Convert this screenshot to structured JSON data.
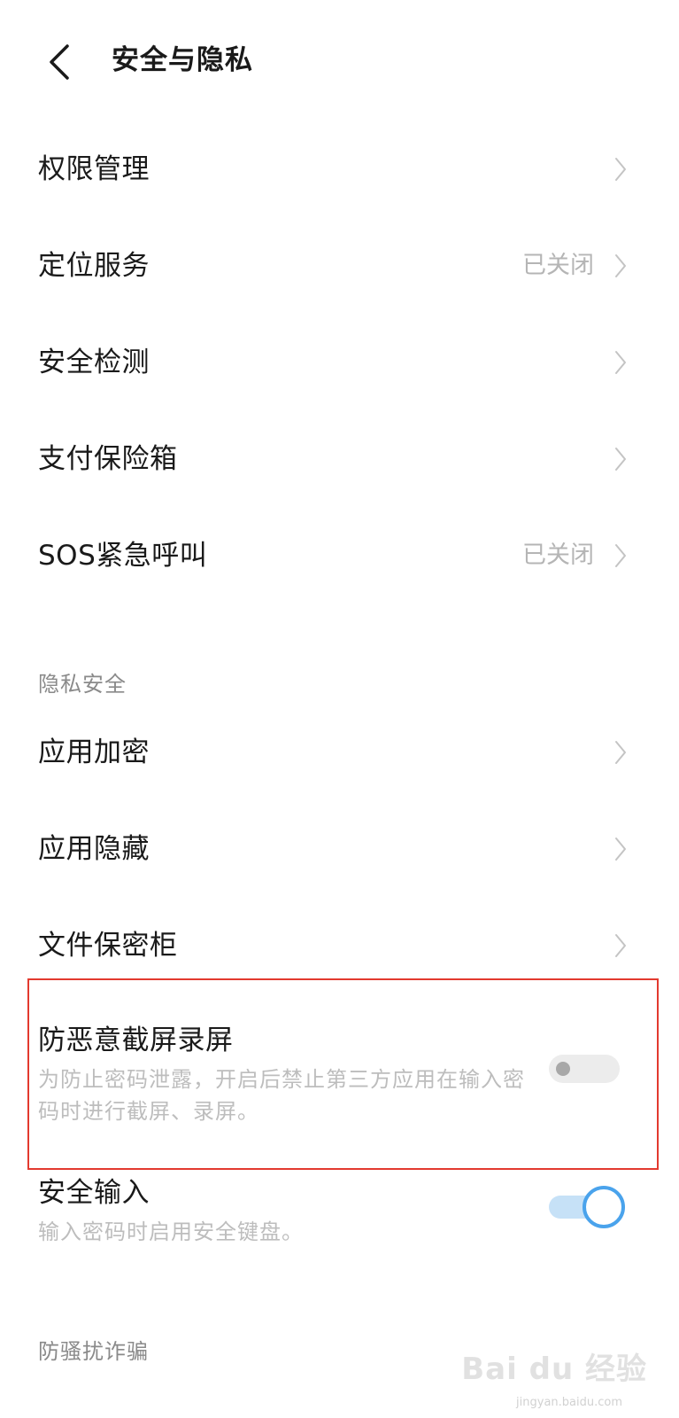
{
  "header": {
    "title": "安全与隐私"
  },
  "main_items": [
    {
      "label": "权限管理",
      "status": ""
    },
    {
      "label": "定位服务",
      "status": "已关闭"
    },
    {
      "label": "安全检测",
      "status": ""
    },
    {
      "label": "支付保险箱",
      "status": ""
    },
    {
      "label": "SOS紧急呼叫",
      "status": "已关闭"
    }
  ],
  "privacy_section": {
    "header": "隐私安全",
    "items": [
      {
        "label": "应用加密"
      },
      {
        "label": "应用隐藏"
      },
      {
        "label": "文件保密柜"
      }
    ]
  },
  "toggles": [
    {
      "title": "防恶意截屏录屏",
      "description": "为防止密码泄露，开启后禁止第三方应用在输入密码时进行截屏、录屏。",
      "enabled": false
    },
    {
      "title": "安全输入",
      "description": "输入密码时启用安全键盘。",
      "enabled": true
    }
  ],
  "anti_fraud_section": {
    "header": "防骚扰诈骗"
  },
  "watermark": {
    "logo": "Bai du 经验",
    "url": "jingyan.baidu.com"
  },
  "colors": {
    "highlight_border": "#e33a2f",
    "switch_on_accent": "#4aa3ec",
    "switch_on_track": "#c6e1f7",
    "secondary_text": "#b5b5b5"
  }
}
